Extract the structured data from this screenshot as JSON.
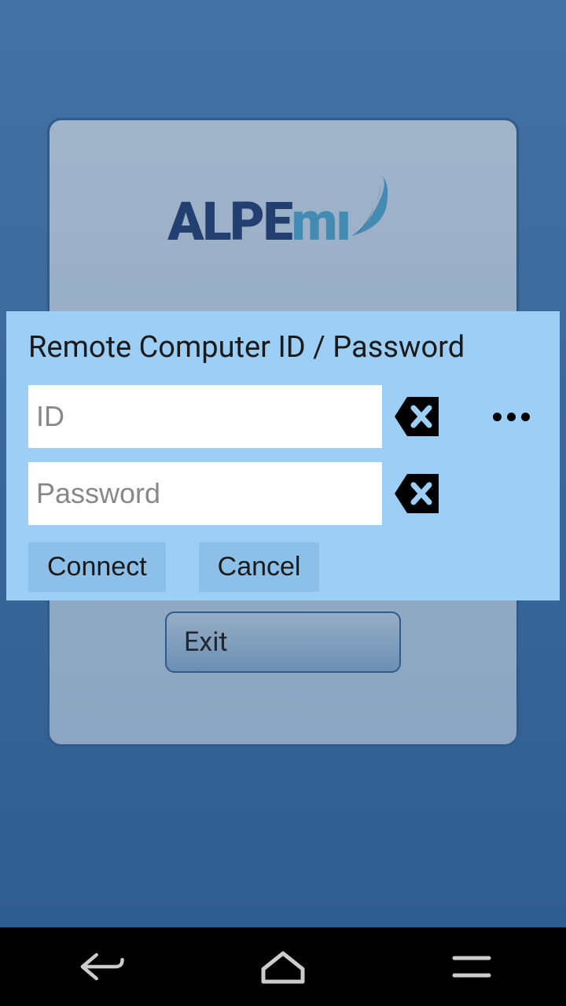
{
  "logo": {
    "part1": "ALPE",
    "part2": "mı"
  },
  "background": {
    "exit_label": "Exit"
  },
  "dialog": {
    "title": "Remote Computer ID / Password",
    "id_placeholder": "ID",
    "id_value": "",
    "password_placeholder": "Password",
    "password_value": "",
    "connect_label": "Connect",
    "cancel_label": "Cancel"
  }
}
